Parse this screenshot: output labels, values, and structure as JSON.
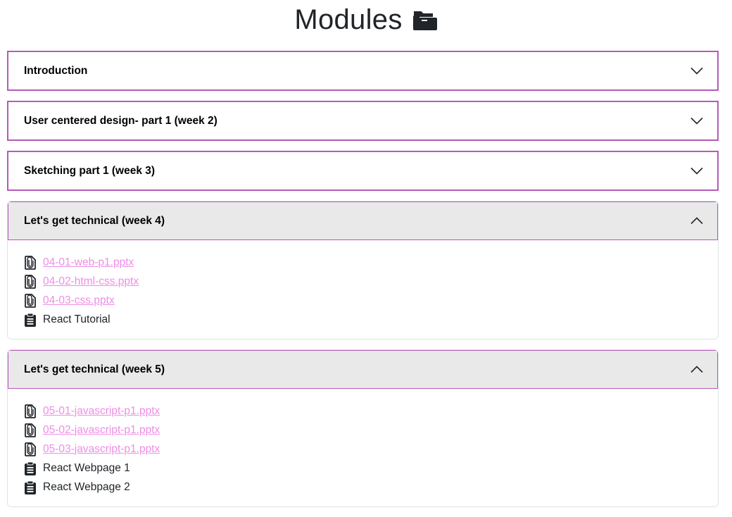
{
  "page": {
    "title": "Modules",
    "title_icon": "folder-open-icon"
  },
  "colors": {
    "header_border": "#b65ab9",
    "open_header_bg": "#e9e9ea",
    "link": "#ee8de6",
    "text": "#212529"
  },
  "modules": [
    {
      "title": "Introduction",
      "expanded": false,
      "chevron": "chevron-down-icon",
      "items": []
    },
    {
      "title": "User centered design- part 1 (week 2)",
      "expanded": false,
      "chevron": "chevron-down-icon",
      "items": []
    },
    {
      "title": "Sketching part 1 (week 3)",
      "expanded": false,
      "chevron": "chevron-down-icon",
      "items": []
    },
    {
      "title": "Let's get technical (week 4)",
      "expanded": true,
      "chevron": "chevron-up-icon",
      "items": [
        {
          "type": "file",
          "icon": "paperclip-file-icon",
          "label": "04-01-web-p1.pptx"
        },
        {
          "type": "file",
          "icon": "paperclip-file-icon",
          "label": "04-02-html-css.pptx"
        },
        {
          "type": "file",
          "icon": "paperclip-file-icon",
          "label": "04-03-css.pptx"
        },
        {
          "type": "assignment",
          "icon": "clipboard-icon",
          "label": "React Tutorial"
        }
      ]
    },
    {
      "title": "Let's get technical (week 5)",
      "expanded": true,
      "chevron": "chevron-up-icon",
      "items": [
        {
          "type": "file",
          "icon": "paperclip-file-icon",
          "label": "05-01-javascript-p1.pptx"
        },
        {
          "type": "file",
          "icon": "paperclip-file-icon",
          "label": "05-02-javascript-p1.pptx"
        },
        {
          "type": "file",
          "icon": "paperclip-file-icon",
          "label": "05-03-javascript-p1.pptx"
        },
        {
          "type": "assignment",
          "icon": "clipboard-icon",
          "label": "React Webpage 1"
        },
        {
          "type": "assignment",
          "icon": "clipboard-icon",
          "label": "React Webpage 2"
        }
      ]
    }
  ]
}
